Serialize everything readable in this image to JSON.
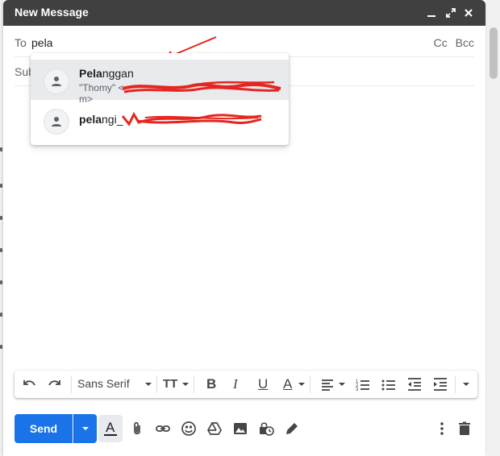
{
  "compose": {
    "title": "New Message",
    "to_label": "To",
    "to_value": "pela",
    "cc_label": "Cc",
    "bcc_label": "Bcc",
    "subject_placeholder": "Subject"
  },
  "suggestions": [
    {
      "name_match": "Pela",
      "name_rest": "nggan",
      "email_prefix": "\"Thomy\" <",
      "email_suffix": "m>",
      "redacted": true
    },
    {
      "name_match": "pela",
      "name_rest": "ngi_",
      "redacted": true
    }
  ],
  "toolbar": {
    "font_family": "Sans Serif",
    "bold_label": "B",
    "italic_label": "I",
    "underline_label": "U",
    "text_color_label": "A",
    "text_size_label": "TT"
  },
  "actions": {
    "send_label": "Send"
  },
  "icons": {
    "minimize": "minimize-icon",
    "fullscreen": "fullscreen-icon",
    "close": "close-icon",
    "undo": "undo-icon",
    "redo": "redo-icon",
    "attach": "paperclip-icon",
    "link": "link-icon",
    "emoji": "emoji-icon",
    "drive": "drive-icon",
    "photo": "photo-icon",
    "confidential": "lock-clock-icon",
    "signature": "pen-icon",
    "more": "more-vert-icon",
    "discard": "trash-icon"
  },
  "colors": {
    "title_bar": "#404040",
    "send_button": "#1a73e8",
    "selected_suggestion": "#e8eaed",
    "annotation_red": "#e52620"
  }
}
